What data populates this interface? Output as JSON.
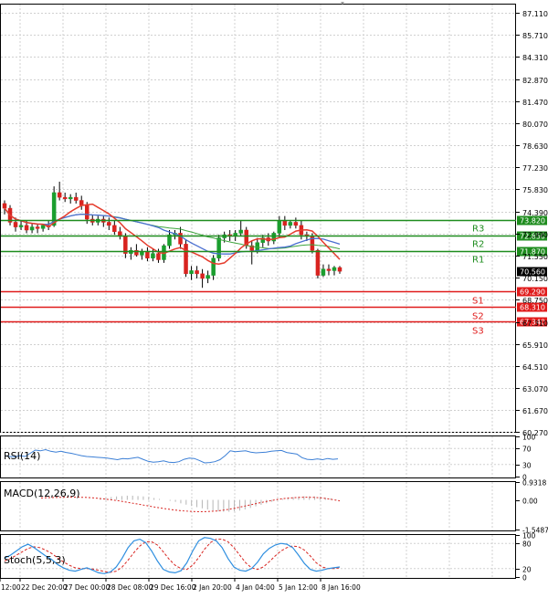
{
  "colors": {
    "background": "#ffffff",
    "grid": "#d0d0d0",
    "resistance": "#1e8c1e",
    "support": "#e01b1b",
    "candle_up": "#1a9e2e",
    "candle_down": "#d8231f",
    "ma_fast": "#e53b2c",
    "ma_slow": "#4a6fd1",
    "ma_mid": "#3ea53e",
    "rsi_line": "#3b7fd6",
    "macd_hist": "#b5b5b5",
    "macd_signal": "#d8231f",
    "stoch_main": "#2f8fe0",
    "stoch_signal": "#d8231f",
    "current_price_box": "#000000"
  },
  "chart_data": [
    {
      "type": "candlestick",
      "panel": "price",
      "title": "",
      "ylim": [
        60.27,
        87.71
      ],
      "y_ticks": [
        "87.110",
        "85.710",
        "84.310",
        "82.870",
        "81.470",
        "80.070",
        "78.630",
        "77.230",
        "75.830",
        "74.390",
        "72.990",
        "71.550",
        "70.150",
        "68.750",
        "67.310",
        "65.910",
        "64.510",
        "63.070",
        "61.670",
        "60.270"
      ],
      "x_tick_labels": [
        "12:00",
        "22 Dec 20:00",
        "27 Dec 00:00",
        "28 Dec 08:00",
        "29 Dec 16:00",
        "2 Jan 20:00",
        "4 Jan 04:00",
        "5 Jan 12:00",
        "8 Jan 16:00"
      ],
      "grid": true,
      "current_price": 70.56,
      "current_price_label": "70.560",
      "levels": [
        {
          "name": "R3",
          "value": 73.82,
          "label": "73.820",
          "kind": "resistance"
        },
        {
          "name": "R2",
          "value": 72.85,
          "label": "72.850",
          "kind": "resistance"
        },
        {
          "name": "R1",
          "value": 71.87,
          "label": "71.870",
          "kind": "resistance"
        },
        {
          "name": "S1",
          "value": 69.29,
          "label": "69.290",
          "kind": "support"
        },
        {
          "name": "S2",
          "value": 68.31,
          "label": "68.310",
          "kind": "support"
        },
        {
          "name": "S3",
          "value": 67.34,
          "label": "67.340",
          "kind": "support"
        }
      ],
      "ohlc": [
        [
          74.9,
          75.1,
          74.2,
          74.6
        ],
        [
          74.6,
          74.8,
          73.5,
          73.7
        ],
        [
          73.7,
          74.0,
          73.1,
          73.4
        ],
        [
          73.4,
          73.8,
          73.2,
          73.5
        ],
        [
          73.5,
          73.8,
          73.0,
          73.2
        ],
        [
          73.2,
          73.6,
          73.0,
          73.4
        ],
        [
          73.4,
          73.6,
          73.0,
          73.3
        ],
        [
          73.3,
          73.6,
          73.1,
          73.5
        ],
        [
          73.5,
          73.8,
          73.2,
          73.4
        ],
        [
          73.5,
          76.0,
          73.4,
          75.6
        ],
        [
          75.6,
          76.3,
          75.1,
          75.3
        ],
        [
          75.3,
          75.6,
          75.0,
          75.2
        ],
        [
          75.2,
          75.5,
          74.9,
          75.3
        ],
        [
          75.3,
          75.6,
          74.9,
          75.1
        ],
        [
          75.1,
          75.4,
          74.5,
          74.8
        ],
        [
          74.8,
          75.0,
          73.6,
          73.9
        ],
        [
          73.9,
          74.2,
          73.5,
          73.7
        ],
        [
          73.7,
          74.1,
          73.5,
          73.9
        ],
        [
          73.9,
          74.1,
          73.4,
          73.7
        ],
        [
          73.7,
          74.0,
          73.2,
          73.5
        ],
        [
          73.5,
          73.8,
          72.9,
          73.1
        ],
        [
          73.1,
          73.4,
          72.6,
          72.8
        ],
        [
          72.8,
          73.0,
          71.4,
          71.7
        ],
        [
          71.7,
          72.1,
          71.3,
          71.9
        ],
        [
          71.9,
          72.3,
          71.5,
          71.6
        ],
        [
          71.6,
          72.0,
          71.3,
          71.8
        ],
        [
          71.8,
          72.1,
          71.2,
          71.4
        ],
        [
          71.4,
          72.0,
          71.2,
          71.7
        ],
        [
          71.7,
          72.0,
          71.1,
          71.3
        ],
        [
          71.3,
          72.3,
          71.1,
          72.2
        ],
        [
          72.2,
          73.2,
          72.0,
          72.9
        ],
        [
          72.9,
          73.2,
          72.6,
          73.0
        ],
        [
          73.0,
          73.4,
          72.0,
          72.3
        ],
        [
          72.3,
          72.6,
          70.2,
          70.4
        ],
        [
          70.4,
          70.9,
          70.0,
          70.6
        ],
        [
          70.6,
          70.9,
          70.1,
          70.4
        ],
        [
          70.4,
          70.7,
          69.5,
          70.1
        ],
        [
          70.1,
          70.6,
          69.8,
          70.3
        ],
        [
          70.3,
          71.6,
          70.0,
          71.4
        ],
        [
          71.4,
          72.9,
          71.2,
          72.7
        ],
        [
          72.7,
          73.1,
          72.4,
          72.9
        ],
        [
          72.9,
          73.2,
          72.5,
          72.8
        ],
        [
          72.8,
          73.2,
          72.5,
          73.0
        ],
        [
          73.0,
          73.8,
          72.8,
          73.2
        ],
        [
          73.2,
          73.4,
          72.0,
          72.2
        ],
        [
          72.2,
          72.5,
          71.0,
          71.9
        ],
        [
          71.9,
          72.7,
          71.7,
          72.4
        ],
        [
          72.4,
          72.9,
          72.1,
          72.7
        ],
        [
          72.7,
          73.0,
          72.2,
          72.5
        ],
        [
          72.5,
          73.1,
          72.3,
          73.0
        ],
        [
          73.0,
          74.1,
          72.7,
          73.8
        ],
        [
          73.8,
          74.1,
          73.2,
          73.5
        ],
        [
          73.5,
          73.8,
          73.3,
          73.7
        ],
        [
          73.7,
          74.0,
          73.3,
          73.5
        ],
        [
          73.5,
          73.8,
          72.6,
          72.9
        ],
        [
          72.9,
          73.1,
          72.5,
          72.8
        ],
        [
          72.8,
          73.0,
          71.7,
          71.9
        ],
        [
          71.9,
          72.0,
          70.1,
          70.3
        ],
        [
          70.3,
          71.0,
          70.2,
          70.7
        ],
        [
          70.7,
          71.0,
          70.3,
          70.6
        ],
        [
          70.6,
          70.9,
          70.3,
          70.8
        ],
        [
          70.8,
          70.9,
          70.4,
          70.56
        ]
      ]
    },
    {
      "type": "line",
      "panel": "rsi",
      "title": "RSI(14)",
      "ylim": [
        0,
        100
      ],
      "y_ticks": [
        "100",
        "70",
        "30",
        "0"
      ],
      "values": [
        52,
        50,
        49,
        52,
        50,
        58,
        66,
        64,
        67,
        63,
        61,
        63,
        60,
        58,
        55,
        52,
        50,
        49,
        48,
        47,
        46,
        44,
        42,
        45,
        44,
        46,
        48,
        43,
        38,
        36,
        37,
        39,
        36,
        35,
        37,
        43,
        46,
        45,
        40,
        34,
        35,
        37,
        42,
        52,
        64,
        62,
        63,
        64,
        61,
        59,
        60,
        61,
        63,
        64,
        65,
        60,
        58,
        56,
        47,
        43,
        42,
        44,
        42,
        45,
        43,
        44
      ]
    },
    {
      "type": "bar+line",
      "panel": "macd",
      "title": "MACD(12,26,9)",
      "y_ticks": [
        "0.9318",
        "0.00",
        "-1.5487"
      ],
      "ylim": [
        -1.5487,
        0.9318
      ],
      "histogram": [
        0.05,
        0.1,
        0.15,
        0.18,
        0.2,
        0.22,
        0.22,
        0.2,
        0.18,
        0.15,
        0.1,
        0.05,
        0.0,
        -0.05,
        -0.1,
        -0.18,
        -0.25,
        -0.32,
        -0.38,
        -0.44,
        -0.5,
        -0.55,
        -0.6,
        -0.62,
        -0.62,
        -0.6,
        -0.56,
        -0.5,
        -0.42,
        -0.34,
        -0.26,
        -0.18,
        -0.1,
        -0.02,
        0.05,
        0.1,
        0.14,
        0.17,
        0.19,
        0.19,
        0.18,
        0.16,
        0.12,
        0.08,
        0.02
      ],
      "signal": [
        0.1,
        0.12,
        0.13,
        0.14,
        0.14,
        0.13,
        0.1,
        0.06,
        0.0,
        -0.06,
        -0.14,
        -0.22,
        -0.3,
        -0.38,
        -0.45,
        -0.52,
        -0.57,
        -0.6,
        -0.62,
        -0.61,
        -0.58,
        -0.52,
        -0.44,
        -0.34,
        -0.24,
        -0.14,
        -0.05,
        0.03,
        0.09,
        0.12,
        0.14,
        0.13,
        0.1,
        0.03,
        -0.05
      ]
    },
    {
      "type": "line",
      "panel": "stoch",
      "title": "Stoch(5,5,3)",
      "ylim": [
        0,
        100
      ],
      "y_ticks": [
        "100",
        "80",
        "20",
        "0"
      ],
      "main": [
        45,
        52,
        62,
        72,
        78,
        70,
        60,
        50,
        42,
        30,
        22,
        16,
        14,
        18,
        22,
        16,
        10,
        8,
        12,
        24,
        45,
        70,
        86,
        90,
        82,
        62,
        38,
        18,
        12,
        10,
        15,
        34,
        62,
        86,
        94,
        92,
        86,
        70,
        44,
        24,
        16,
        14,
        20,
        35,
        55,
        68,
        76,
        80,
        78,
        70,
        52,
        32,
        18,
        14,
        16,
        20,
        22,
        24
      ],
      "signal": [
        38,
        44,
        52,
        60,
        68,
        72,
        70,
        64,
        56,
        46,
        36,
        28,
        22,
        20,
        20,
        19,
        16,
        13,
        11,
        14,
        24,
        40,
        58,
        74,
        84,
        84,
        76,
        60,
        42,
        28,
        20,
        18,
        28,
        46,
        66,
        82,
        90,
        90,
        84,
        70,
        52,
        34,
        22,
        18,
        24,
        36,
        50,
        62,
        70,
        74,
        72,
        64,
        50,
        34,
        24,
        20,
        20,
        22
      ]
    }
  ]
}
